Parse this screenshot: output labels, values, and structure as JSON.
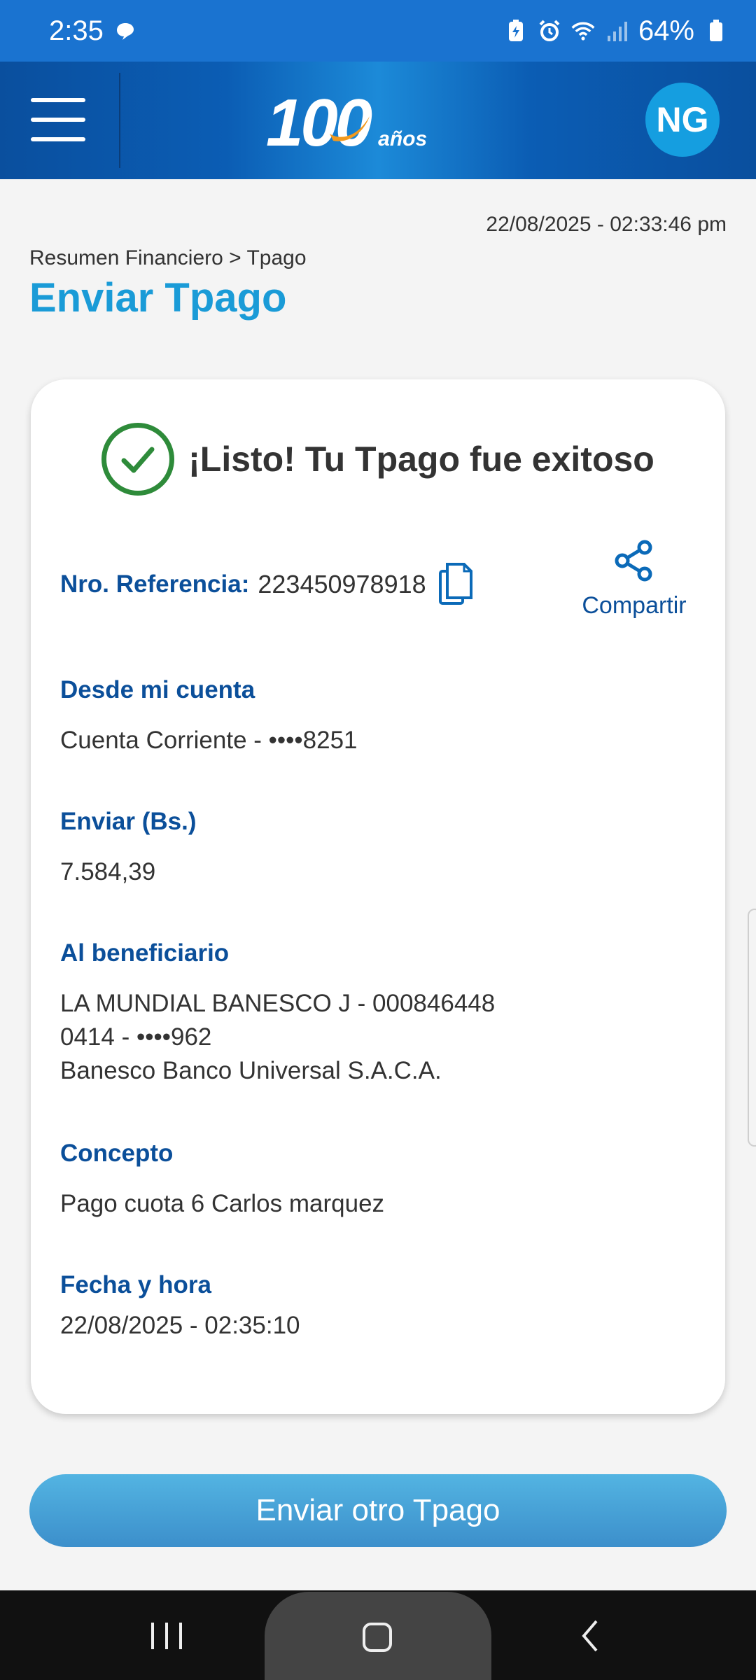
{
  "status_bar": {
    "time": "2:35",
    "battery": "64%",
    "icons": [
      "chat-bubble-icon",
      "battery-saver-icon",
      "alarm-icon",
      "wifi-icon",
      "signal-icon",
      "battery-icon"
    ]
  },
  "app_bar": {
    "logo_number": "100",
    "logo_suffix": "años",
    "avatar_initials": "NG"
  },
  "header": {
    "timestamp": "22/08/2025 - 02:33:46 pm",
    "breadcrumb": "Resumen Financiero > Tpago",
    "title": "Enviar Tpago"
  },
  "receipt": {
    "success_message": "¡Listo! Tu Tpago fue exitoso",
    "reference_label": "Nro. Referencia:",
    "reference_value": "223450978918",
    "share_label": "Compartir",
    "from_label": "Desde mi cuenta",
    "from_value": "Cuenta Corriente - ••••8251",
    "amount_label": "Enviar (Bs.)",
    "amount_value": "7.584,39",
    "beneficiary_label": "Al beneficiario",
    "beneficiary_name": "LA MUNDIAL BANESCO J - 000846448",
    "beneficiary_phone": "0414 - ••••962",
    "beneficiary_bank": "Banesco Banco Universal S.A.C.A.",
    "concept_label": "Concepto",
    "concept_value": "Pago cuota 6 Carlos marquez",
    "datetime_label": "Fecha y hora",
    "datetime_value": "22/08/2025 - 02:35:10"
  },
  "actions": {
    "send_another_label": "Enviar otro Tpago"
  },
  "colors": {
    "primary_blue": "#0b4f9a",
    "title_blue": "#1a9bd7",
    "success_green": "#2e8b3a",
    "status_bar": "#1a73d0"
  }
}
